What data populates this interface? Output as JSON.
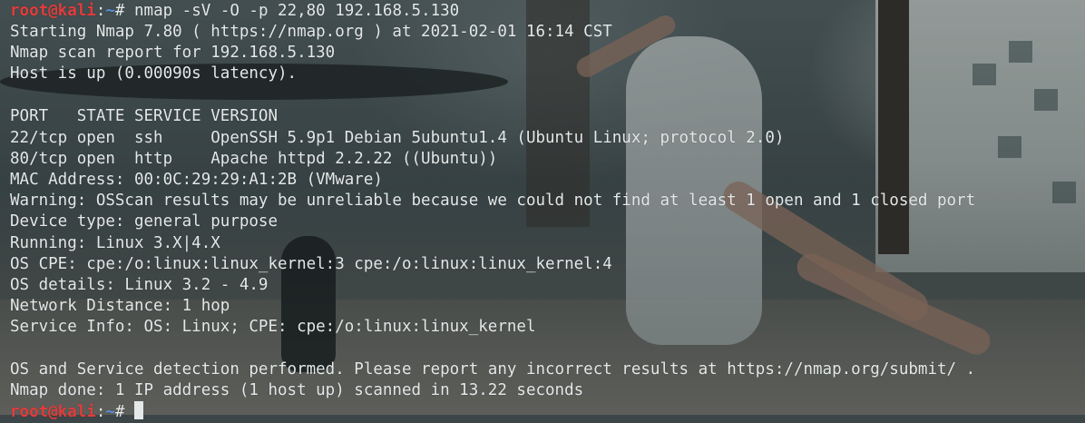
{
  "theme": {
    "text": "#e4e8e8",
    "prompt_user": "#e23c3c",
    "prompt_path": "#5a8fe0"
  },
  "prompt": {
    "user_host": "root@kali",
    "separator": ":",
    "path": "~",
    "symbol": "# "
  },
  "command": "nmap -sV -O -p 22,80 192.168.5.130",
  "output": [
    "Starting Nmap 7.80 ( https://nmap.org ) at 2021-02-01 16:14 CST",
    "Nmap scan report for 192.168.5.130",
    "Host is up (0.00090s latency).",
    "",
    "PORT   STATE SERVICE VERSION",
    "22/tcp open  ssh     OpenSSH 5.9p1 Debian 5ubuntu1.4 (Ubuntu Linux; protocol 2.0)",
    "80/tcp open  http    Apache httpd 2.2.22 ((Ubuntu))",
    "MAC Address: 00:0C:29:29:A1:2B (VMware)",
    "Warning: OSScan results may be unreliable because we could not find at least 1 open and 1 closed port",
    "Device type: general purpose",
    "Running: Linux 3.X|4.X",
    "OS CPE: cpe:/o:linux:linux_kernel:3 cpe:/o:linux:linux_kernel:4",
    "OS details: Linux 3.2 - 4.9",
    "Network Distance: 1 hop",
    "Service Info: OS: Linux; CPE: cpe:/o:linux:linux_kernel",
    "",
    "OS and Service detection performed. Please report any incorrect results at https://nmap.org/submit/ .",
    "Nmap done: 1 IP address (1 host up) scanned in 13.22 seconds"
  ]
}
